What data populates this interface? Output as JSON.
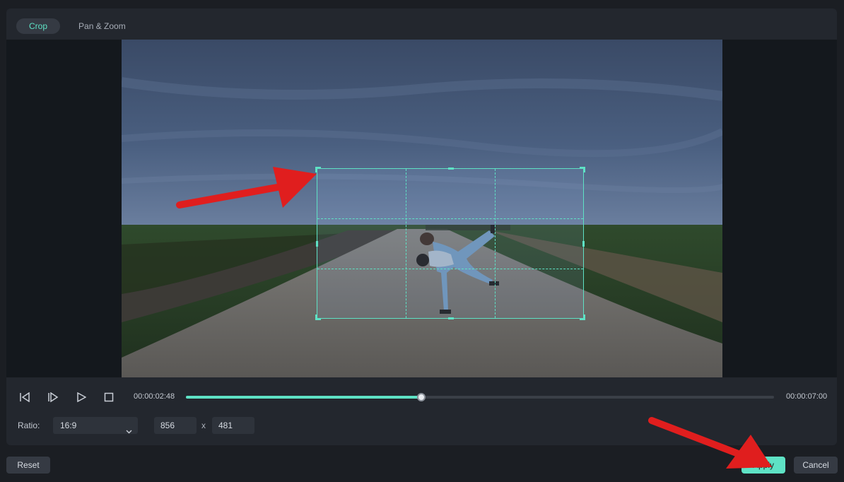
{
  "tabs": [
    {
      "label": "Crop",
      "active": true
    },
    {
      "label": "Pan & Zoom",
      "active": false
    }
  ],
  "playback": {
    "current_time": "00:00:02:48",
    "total_time": "00:00:07:00",
    "progress": 0.4
  },
  "crop": {
    "ratio_label": "Ratio:",
    "ratio_value": "16:9",
    "width": "856",
    "times": "x",
    "height": "481"
  },
  "buttons": {
    "reset": "Reset",
    "apply": "Apply",
    "cancel": "Cancel"
  },
  "colors": {
    "accent": "#5ee2c5",
    "annotation_arrow": "#e01e1e"
  },
  "icons": [
    "prev-frame-icon",
    "next-frame-icon",
    "play-icon",
    "stop-icon",
    "chevron-down-icon"
  ]
}
